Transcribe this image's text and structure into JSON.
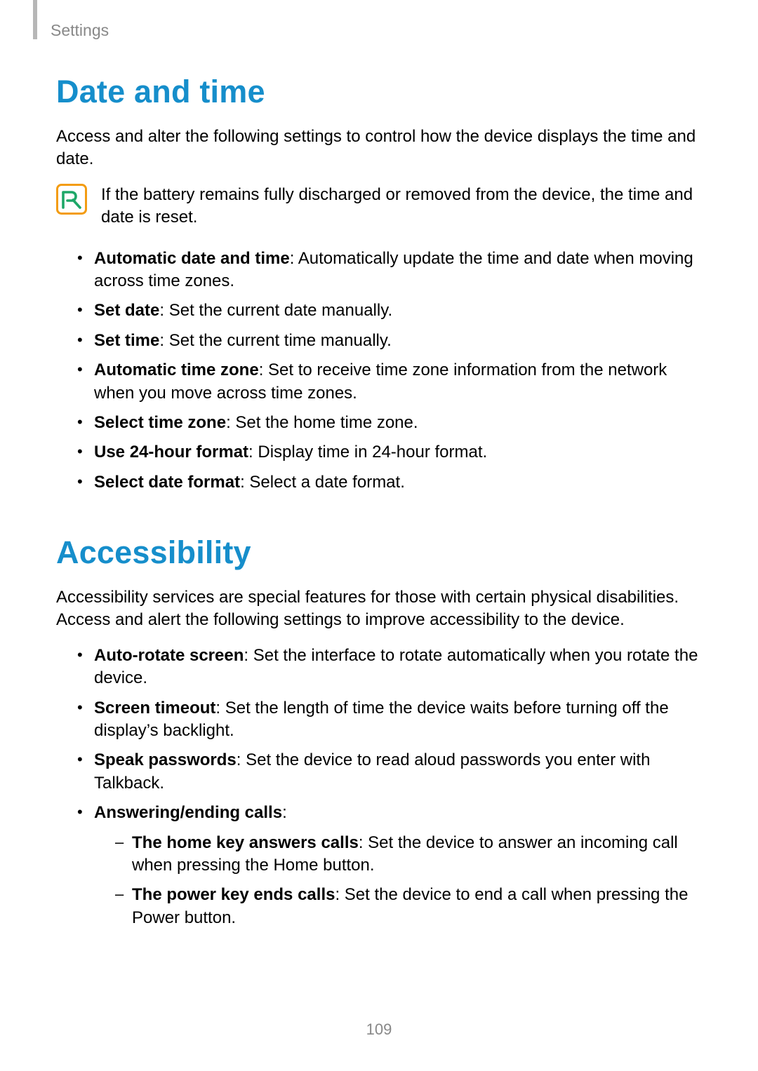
{
  "section_label": "Settings",
  "page_number": "109",
  "section1": {
    "heading": "Date and time",
    "intro": "Access and alter the following settings to control how the device displays the time and date.",
    "note": "If the battery remains fully discharged or removed from the device, the time and date is reset.",
    "items": [
      {
        "label": "Automatic date and time",
        "desc": ": Automatically update the time and date when moving across time zones."
      },
      {
        "label": "Set date",
        "desc": ": Set the current date manually."
      },
      {
        "label": "Set time",
        "desc": ": Set the current time manually."
      },
      {
        "label": "Automatic time zone",
        "desc": ": Set to receive time zone information from the network when you move across time zones."
      },
      {
        "label": "Select time zone",
        "desc": ": Set the home time zone."
      },
      {
        "label": "Use 24-hour format",
        "desc": ": Display time in 24-hour format."
      },
      {
        "label": "Select date format",
        "desc": ": Select a date format."
      }
    ]
  },
  "section2": {
    "heading": "Accessibility",
    "intro": "Accessibility services are special features for those with certain physical disabilities. Access and alert the following settings to improve accessibility to the device.",
    "items": [
      {
        "label": "Auto-rotate screen",
        "desc": ": Set the interface to rotate automatically when you rotate the device."
      },
      {
        "label": "Screen timeout",
        "desc": ": Set the length of time the device waits before turning off the display’s backlight."
      },
      {
        "label": "Speak passwords",
        "desc": ": Set the device to read aloud passwords you enter with Talkback."
      },
      {
        "label": "Answering/ending calls",
        "desc": ":",
        "subitems": [
          {
            "label": "The home key answers calls",
            "desc": ": Set the device to answer an incoming call when pressing the Home button."
          },
          {
            "label": "The power key ends calls",
            "desc": ": Set the device to end a call when pressing the Power button."
          }
        ]
      }
    ]
  }
}
